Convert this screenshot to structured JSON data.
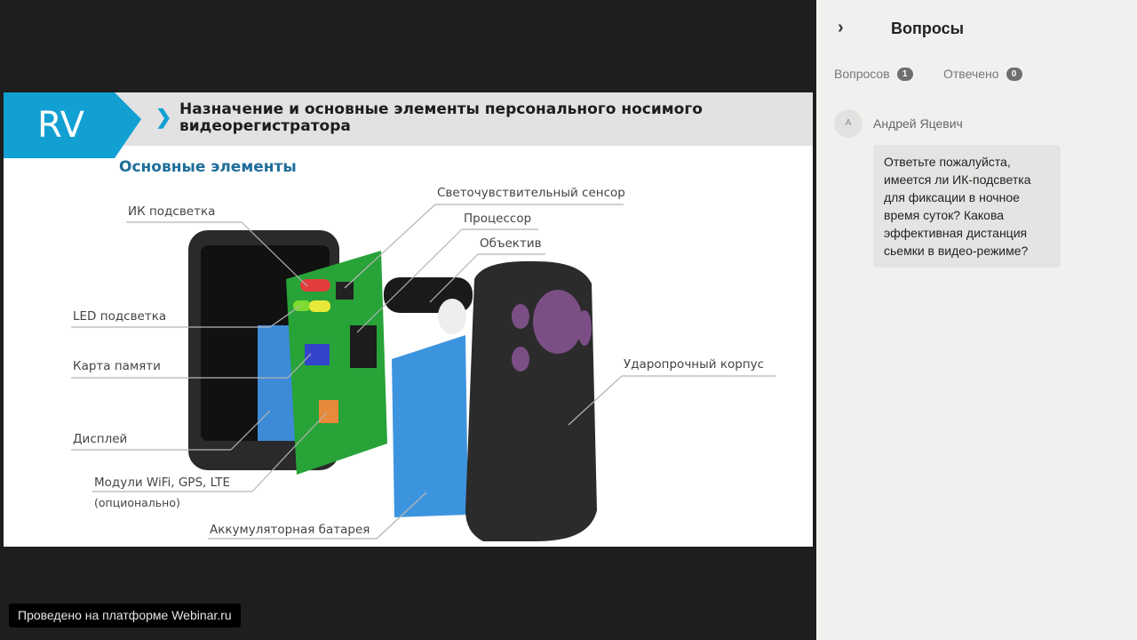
{
  "slide": {
    "logo": "RV",
    "title": "Назначение и основные элементы персонального носимого видеорегистратора",
    "subtitle": "Основные элементы",
    "labels": {
      "sensor": "Светочувствительный сенсор",
      "processor": "Процессор",
      "lens": "Объектив",
      "ir": "ИК подсветка",
      "led": "LED подсветка",
      "memory": "Карта памяти",
      "display": "Дисплей",
      "modules": "Модули WiFi, GPS, LTE",
      "optional": "(опционально)",
      "battery": "Аккумуляторная батарея",
      "case": "Ударопрочный корпус"
    }
  },
  "footer": "Проведено на платформе Webinar.ru",
  "panel": {
    "title": "Вопросы",
    "tabs": [
      {
        "label": "Вопросов",
        "count": "1"
      },
      {
        "label": "Отвечено",
        "count": "0"
      }
    ],
    "question": {
      "avatar": "А",
      "author": "Андрей Яцевич",
      "text": "Ответьте пожалуйста, имеется ли ИК-подсветка для фиксации в ночное время суток? Какова эффективная дистанция сьемки в видео-режиме?"
    }
  },
  "colors": {
    "brand": "#12a0d3",
    "panel_bg": "#f0f0ee",
    "stage_bg": "#1d1e1e"
  }
}
